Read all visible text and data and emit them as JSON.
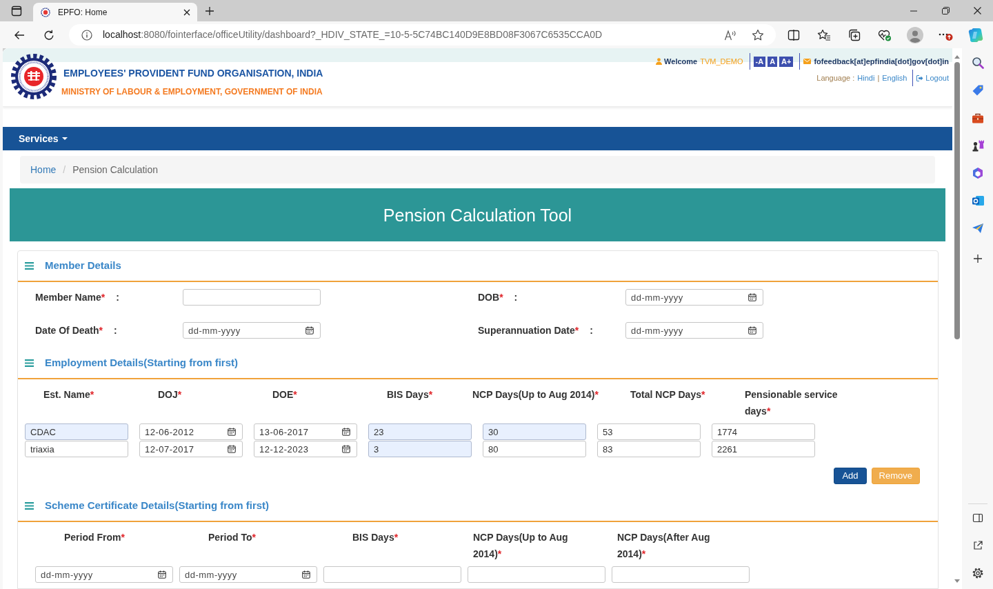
{
  "browser": {
    "tab": {
      "title": "EPFO: Home"
    },
    "address_bar": {
      "host": "localhost",
      "path": ":8080/fointerface/officeUtility/dashboard?_HDIV_STATE_=10-5-5C74BC140D9E8BD08F3067C6535CCA0D"
    }
  },
  "header": {
    "org_name": "EMPLOYEES' PROVIDENT FUND ORGANISATION, INDIA",
    "ministry": "MINISTRY OF LABOUR & EMPLOYMENT, GOVERNMENT OF INDIA",
    "welcome": "Welcome",
    "username": "TVM_DEMO",
    "font_size_buttons": [
      "-A",
      "A",
      "A+"
    ],
    "email": "fofeedback[at]epfindia[dot]gov[dot]in",
    "language_label": "Language :",
    "languages": [
      {
        "label": "Hindi"
      },
      {
        "label": "English"
      }
    ],
    "language_separator": "|",
    "logout": "Logout"
  },
  "nav": {
    "items": [
      {
        "label": "Services",
        "dropdown": true
      }
    ]
  },
  "breadcrumb": {
    "items": [
      {
        "label": "Home",
        "kind": "link"
      },
      {
        "label": "Pension Calculation",
        "kind": "current"
      }
    ],
    "separator": "/"
  },
  "banner": {
    "title": "Pension Calculation Tool"
  },
  "member_details": {
    "title": "Member Details",
    "fields": [
      {
        "label": "Member Name",
        "required_mark": "*",
        "separator": ":",
        "kind": "text"
      },
      {
        "label": "DOB",
        "required_mark": "*",
        "separator": ":",
        "kind": "date",
        "placeholder": "dd-mm-yyyy"
      },
      {
        "label": "Date Of Death",
        "required_mark": "*",
        "separator": ":",
        "kind": "date",
        "placeholder": "dd-mm-yyyy"
      },
      {
        "label": "Superannuation Date",
        "required_mark": "*",
        "separator": ":",
        "kind": "date",
        "placeholder": "dd-mm-yyyy"
      }
    ]
  },
  "employment_details": {
    "title": "Employment Details(Starting from first)",
    "columns": [
      {
        "label": "Est. Name",
        "required_mark": "*"
      },
      {
        "label": "DOJ",
        "required_mark": "*"
      },
      {
        "label": "DOE",
        "required_mark": "*"
      },
      {
        "label": "BIS Days",
        "required_mark": "*"
      },
      {
        "label": "NCP Days(Up to Aug 2014)",
        "required_mark": "*"
      },
      {
        "label": "Total NCP Days",
        "required_mark": "*"
      },
      {
        "label": "Pensionable service days",
        "required_mark": "*"
      }
    ],
    "rows": [
      [
        {
          "kind": "text",
          "value": "CDAC",
          "autofilled": true
        },
        {
          "kind": "date",
          "value": "12-06-2012",
          "autofilled": false
        },
        {
          "kind": "date",
          "value": "13-06-2017",
          "autofilled": false
        },
        {
          "kind": "text",
          "value": "23",
          "autofilled": true
        },
        {
          "kind": "text",
          "value": "30",
          "autofilled": true
        },
        {
          "kind": "text",
          "value": "53",
          "autofilled": false
        },
        {
          "kind": "text",
          "value": "1774",
          "autofilled": false
        }
      ],
      [
        {
          "kind": "text",
          "value": "triaxia",
          "autofilled": false
        },
        {
          "kind": "date",
          "value": "12-07-2017",
          "autofilled": false
        },
        {
          "kind": "date",
          "value": "12-12-2023",
          "autofilled": false
        },
        {
          "kind": "text",
          "value": "3",
          "autofilled": true
        },
        {
          "kind": "text",
          "value": "80",
          "autofilled": false
        },
        {
          "kind": "text",
          "value": "83",
          "autofilled": false
        },
        {
          "kind": "text",
          "value": "2261",
          "autofilled": false
        }
      ]
    ],
    "buttons": [
      {
        "label": "Add",
        "kind": "primary"
      },
      {
        "label": "Remove",
        "kind": "warning"
      }
    ]
  },
  "scheme_certificate_details": {
    "title": "Scheme Certificate Details(Starting from first)",
    "columns": [
      {
        "label": "Period From",
        "required_mark": "*"
      },
      {
        "label": "Period To",
        "required_mark": "*"
      },
      {
        "label": "BIS Days",
        "required_mark": "*"
      },
      {
        "label": "NCP Days(Up to Aug 2014)",
        "required_mark": "*"
      },
      {
        "label": "NCP Days(After Aug 2014)",
        "required_mark": "*"
      }
    ],
    "rows": [
      [
        {
          "kind": "date",
          "placeholder": "dd-mm-yyyy"
        },
        {
          "kind": "date",
          "placeholder": "dd-mm-yyyy"
        },
        {
          "kind": "text"
        },
        {
          "kind": "text"
        },
        {
          "kind": "text"
        }
      ]
    ]
  }
}
